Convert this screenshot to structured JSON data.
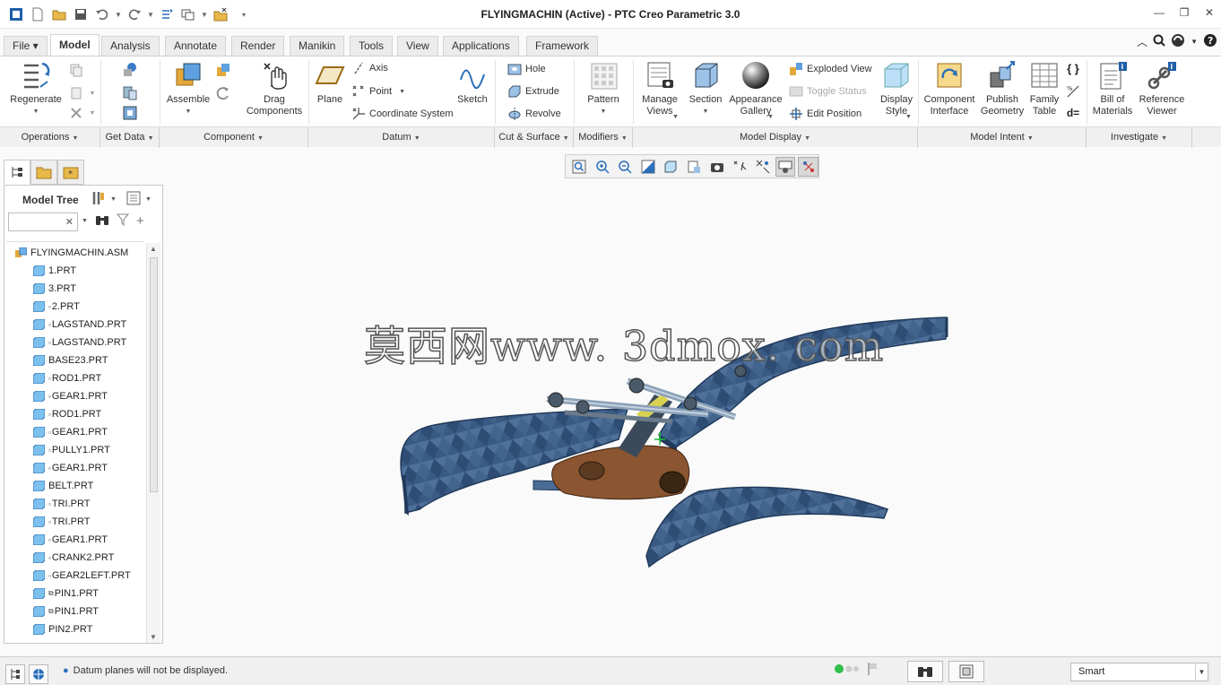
{
  "window": {
    "title": "FLYINGMACHIN (Active) - PTC Creo Parametric 3.0",
    "controls": [
      "minimize-icon",
      "restore-icon",
      "close-icon"
    ]
  },
  "quick_access": [
    "app-icon",
    "new-icon",
    "open-icon",
    "save-icon",
    "undo-icon",
    "redo-icon",
    "regenerate-icon",
    "windows-icon",
    "close-window-icon",
    "customize-icon"
  ],
  "tabs": [
    {
      "label": "File ▾"
    },
    {
      "label": "Model"
    },
    {
      "label": "Analysis"
    },
    {
      "label": "Annotate"
    },
    {
      "label": "Render"
    },
    {
      "label": "Manikin"
    },
    {
      "label": "Tools"
    },
    {
      "label": "View"
    },
    {
      "label": "Applications"
    },
    {
      "label": "Framework"
    }
  ],
  "active_tab": "Model",
  "ribbon": {
    "regenerate": "Regenerate",
    "assemble": "Assemble",
    "drag_components": "Drag\nComponents",
    "plane": "Plane",
    "axis": "Axis",
    "point": "Point",
    "coordinate_system": "Coordinate System",
    "sketch": "Sketch",
    "hole": "Hole",
    "extrude": "Extrude",
    "revolve": "Revolve",
    "pattern": "Pattern",
    "manage_views": "Manage\nViews",
    "section": "Section",
    "appearance_gallery": "Appearance\nGallery",
    "exploded_view": "Exploded View",
    "toggle_status": "Toggle Status",
    "edit_position": "Edit Position",
    "display_style": "Display\nStyle",
    "component_interface": "Component\nInterface",
    "publish_geometry": "Publish\nGeometry",
    "family_table": "Family\nTable",
    "bill_of_materials": "Bill of\nMaterials",
    "reference_viewer": "Reference\nViewer"
  },
  "groups": [
    {
      "label": "Operations"
    },
    {
      "label": "Get Data"
    },
    {
      "label": "Component"
    },
    {
      "label": "Datum"
    },
    {
      "label": "Cut & Surface"
    },
    {
      "label": "Modifiers"
    },
    {
      "label": "Model Display"
    },
    {
      "label": "Model Intent"
    },
    {
      "label": "Investigate"
    }
  ],
  "panel": {
    "title": "Model Tree",
    "search_value": "",
    "root": "FLYINGMACHIN.ASM",
    "items": [
      {
        "label": "1.PRT",
        "flag": ""
      },
      {
        "label": "3.PRT",
        "flag": ""
      },
      {
        "label": "2.PRT",
        "flag": "▫"
      },
      {
        "label": "LAGSTAND.PRT",
        "flag": "▫"
      },
      {
        "label": "LAGSTAND.PRT",
        "flag": "▫"
      },
      {
        "label": "BASE23.PRT",
        "flag": ""
      },
      {
        "label": "ROD1.PRT",
        "flag": "▫"
      },
      {
        "label": "GEAR1.PRT",
        "flag": "▫"
      },
      {
        "label": "ROD1.PRT",
        "flag": "▫"
      },
      {
        "label": "GEAR1.PRT",
        "flag": "▫"
      },
      {
        "label": "PULLY1.PRT",
        "flag": "▫"
      },
      {
        "label": "GEAR1.PRT",
        "flag": "▫"
      },
      {
        "label": "BELT.PRT",
        "flag": ""
      },
      {
        "label": "TRI.PRT",
        "flag": "▫"
      },
      {
        "label": "TRI.PRT",
        "flag": "▫"
      },
      {
        "label": "GEAR1.PRT",
        "flag": "▫"
      },
      {
        "label": "CRANK2.PRT",
        "flag": "▫"
      },
      {
        "label": "GEAR2LEFT.PRT",
        "flag": "▫"
      },
      {
        "label": "PIN1.PRT",
        "flag": "⧉"
      },
      {
        "label": "PIN1.PRT",
        "flag": "⧉"
      },
      {
        "label": "PIN2.PRT",
        "flag": ""
      }
    ]
  },
  "watermark": "莫西网www. 3dmox. com",
  "status": {
    "message": "Datum planes will not be displayed.",
    "filter": "Smart"
  },
  "colors": {
    "wing": "#3e5f86",
    "wing_dark": "#2b4466",
    "mechanism": "#7a4a2a",
    "accent_blue": "#2a6fbb"
  }
}
